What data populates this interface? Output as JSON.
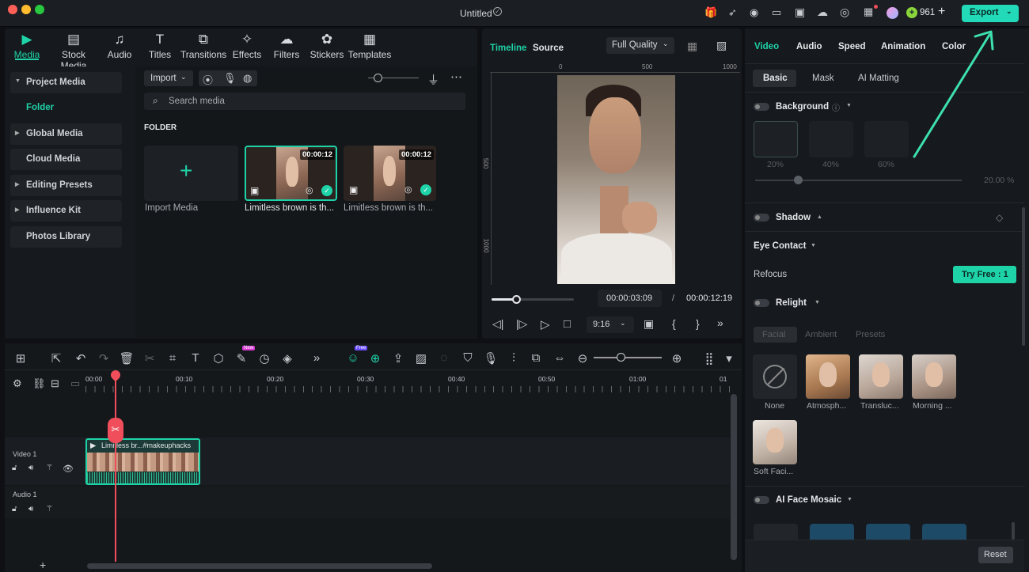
{
  "window": {
    "title": "Untitled",
    "credits": "961",
    "export_label": "Export"
  },
  "top_tabs": [
    {
      "label": "Media",
      "icon": "media-icon"
    },
    {
      "label": "Stock Media",
      "icon": "stock-media-icon"
    },
    {
      "label": "Audio",
      "icon": "audio-icon"
    },
    {
      "label": "Titles",
      "icon": "titles-icon"
    },
    {
      "label": "Transitions",
      "icon": "transitions-icon"
    },
    {
      "label": "Effects",
      "icon": "effects-icon"
    },
    {
      "label": "Filters",
      "icon": "filters-icon"
    },
    {
      "label": "Stickers",
      "icon": "stickers-icon"
    },
    {
      "label": "Templates",
      "icon": "templates-icon"
    }
  ],
  "sidebar": {
    "items": [
      "Project Media",
      "Folder",
      "Global Media",
      "Cloud Media",
      "Editing Presets",
      "Influence Kit",
      "Photos Library"
    ]
  },
  "media": {
    "import_label": "Import",
    "search_placeholder": "Search media",
    "folder_heading": "FOLDER",
    "import_media_label": "Import Media",
    "clips": [
      {
        "duration": "00:00:12",
        "name": "Limitless brown is th..."
      },
      {
        "duration": "00:00:12",
        "name": "Limitless brown is th..."
      }
    ]
  },
  "preview": {
    "tab_timeline": "Timeline",
    "tab_source": "Source",
    "quality": "Full Quality",
    "ruler": [
      "0",
      "500",
      "1000"
    ],
    "vruler": [
      "500",
      "1000"
    ],
    "current_time": "00:00:03:09",
    "separator": "/",
    "total_time": "00:00:12:19",
    "aspect": "9:16",
    "progress": 0.3
  },
  "timeline": {
    "ruler": [
      "00:00",
      "00:10",
      "00:20",
      "00:30",
      "00:40",
      "00:50",
      "01:00",
      "01"
    ],
    "video_track": "Video 1",
    "audio_track": "Audio 1",
    "clip_label": "Limitless br...#makeuphacks",
    "new_badge": "New",
    "free_badge": "Free"
  },
  "properties": {
    "tabs": [
      "Video",
      "Audio",
      "Speed",
      "Animation",
      "Color"
    ],
    "subtabs": [
      "Basic",
      "Mask",
      "AI Matting"
    ],
    "background_label": "Background",
    "blur_options": [
      "20%",
      "40%",
      "60%"
    ],
    "background_value": "20.00",
    "background_unit": "%",
    "shadow_label": "Shadow",
    "eye_contact_label": "Eye Contact",
    "refocus_label": "Refocus",
    "try_free_label": "Try Free : 1",
    "relight_label": "Relight",
    "relight_tabs": [
      "Facial",
      "Ambient",
      "Presets"
    ],
    "relight_presets": [
      "None",
      "Atmosph...",
      "Transluc...",
      "Morning ...",
      "Soft Faci..."
    ],
    "face_mosaic_label": "AI Face Mosaic",
    "reset_label": "Reset"
  },
  "colors": {
    "accent": "#1fd3a8",
    "export_bg": "#22d9b8",
    "playhead": "#ef4e5a"
  }
}
